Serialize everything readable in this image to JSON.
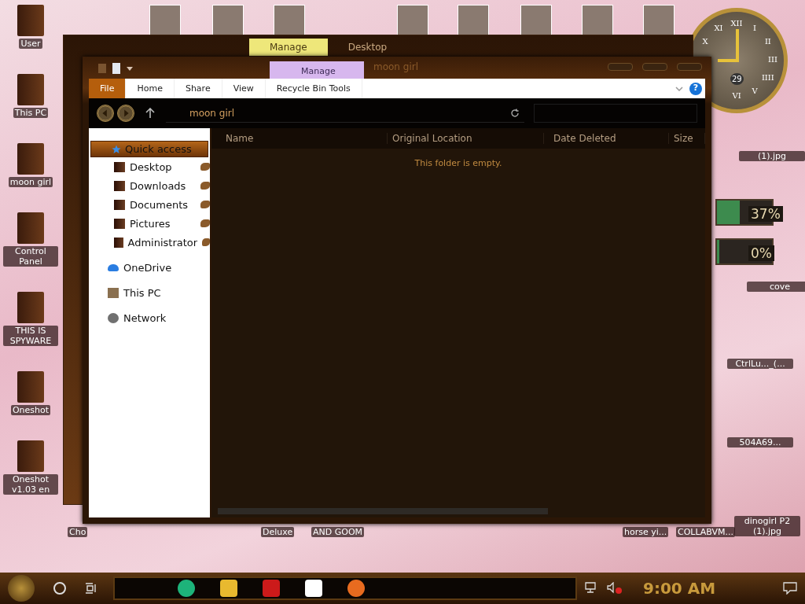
{
  "desktop_icons_left": [
    {
      "label": "User"
    },
    {
      "label": "This PC"
    },
    {
      "label": "moon girl"
    },
    {
      "label": "Control Panel"
    },
    {
      "label": "THIS IS SPYWARE"
    },
    {
      "label": "Oneshot"
    },
    {
      "label": "Oneshot v1.03 en"
    }
  ],
  "desktop_labels_bottom": [
    {
      "label": "Cho"
    },
    {
      "label": "Deluxe"
    },
    {
      "label": "AND GOOM"
    },
    {
      "label": "horse yi..."
    },
    {
      "label": "COLLABVM..."
    }
  ],
  "desktop_icons_right": [
    {
      "label": "(1).jpg"
    },
    {
      "label": "cove"
    },
    {
      "label": "CtrlLu..._(..."
    },
    {
      "label": "504A69..."
    },
    {
      "label": "dinogirl P2 (1).jpg"
    }
  ],
  "clock": {
    "numerals": [
      "XII",
      "I",
      "II",
      "III",
      "IIII",
      "V",
      "VI",
      "X",
      "XI"
    ],
    "date": "29"
  },
  "meters": [
    {
      "reading": "37%",
      "level": 0.37
    },
    {
      "reading": "0%",
      "level": 0
    }
  ],
  "back_window": {
    "tabs": [
      {
        "label": "Manage",
        "selected": true
      },
      {
        "label": "Desktop",
        "selected": false
      }
    ]
  },
  "window": {
    "title": "moon girl",
    "context_tab": "Manage",
    "ribbon_tabs": [
      {
        "label": "File",
        "selected": true
      },
      {
        "label": "Home",
        "selected": false
      },
      {
        "label": "Share",
        "selected": false
      },
      {
        "label": "View",
        "selected": false
      },
      {
        "label": "Recycle Bin Tools",
        "selected": false
      }
    ],
    "address": "moon girl",
    "help_button": "?",
    "nav": [
      {
        "label": "Quick access",
        "selected": true,
        "children": [
          {
            "label": "Desktop",
            "pinned": true
          },
          {
            "label": "Downloads",
            "pinned": true
          },
          {
            "label": "Documents",
            "pinned": true
          },
          {
            "label": "Pictures",
            "pinned": true
          },
          {
            "label": "Administrator",
            "pinned": true
          }
        ]
      },
      {
        "label": "OneDrive",
        "selected": false
      },
      {
        "label": "This PC",
        "selected": false
      },
      {
        "label": "Network",
        "selected": false
      }
    ],
    "columns": [
      "Name",
      "Original Location",
      "Date Deleted",
      "Size"
    ],
    "empty_text": "This folder is empty."
  },
  "taskbar": {
    "time": "9:00 AM"
  }
}
